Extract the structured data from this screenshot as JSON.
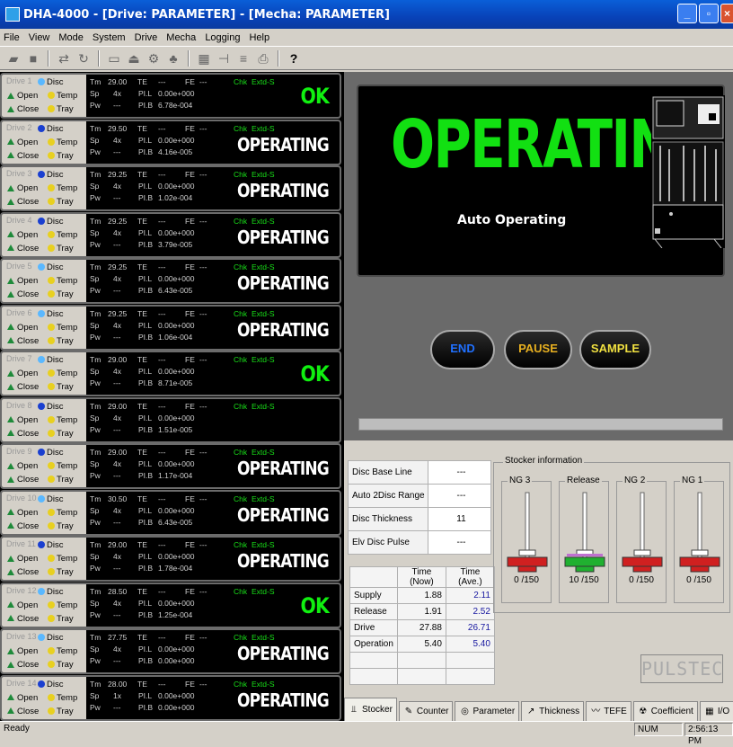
{
  "window": {
    "title": "DHA-4000 - [Drive: PARAMETER] - [Mecha: PARAMETER]"
  },
  "menu": [
    "File",
    "View",
    "Mode",
    "System",
    "Drive",
    "Mecha",
    "Logging",
    "Help"
  ],
  "drive_labels": {
    "disc": "Disc",
    "open": "Open",
    "temp": "Temp",
    "close": "Close",
    "tray": "Tray",
    "tm": "Tm",
    "sp": "Sp",
    "pw": "Pw",
    "te": "TE",
    "fe": "FE",
    "pil": "PI.L",
    "pib": "PI.B",
    "chk": "Chk",
    "extd": "Extd-S",
    "dash": "---"
  },
  "drives": [
    {
      "name": "Drive 1",
      "tm": "29.00",
      "sp": "4x",
      "pil": "0.00e+000",
      "pib": "6.78e-004",
      "status": "OK",
      "chk": "Chk",
      "disc_color": "#5ab8ff"
    },
    {
      "name": "Drive 2",
      "tm": "29.50",
      "sp": "4x",
      "pil": "0.00e+000",
      "pib": "4.16e-005",
      "status": "OPERATING",
      "chk": "",
      "disc_color": "#1a3fd0"
    },
    {
      "name": "Drive 3",
      "tm": "29.25",
      "sp": "4x",
      "pil": "0.00e+000",
      "pib": "1.02e-004",
      "status": "OPERATING",
      "chk": "",
      "disc_color": "#1a3fd0"
    },
    {
      "name": "Drive 4",
      "tm": "29.25",
      "sp": "4x",
      "pil": "0.00e+000",
      "pib": "3.79e-005",
      "status": "OPERATING",
      "chk": "",
      "disc_color": "#1a3fd0"
    },
    {
      "name": "Drive 5",
      "tm": "29.25",
      "sp": "4x",
      "pil": "0.00e+000",
      "pib": "6.43e-005",
      "status": "OPERATING",
      "chk": "",
      "disc_color": "#5ab8ff"
    },
    {
      "name": "Drive 6",
      "tm": "29.25",
      "sp": "4x",
      "pil": "0.00e+000",
      "pib": "1.06e-004",
      "status": "OPERATING",
      "chk": "",
      "disc_color": "#5ab8ff"
    },
    {
      "name": "Drive 7",
      "tm": "29.00",
      "sp": "4x",
      "pil": "0.00e+000",
      "pib": "8.71e-005",
      "status": "OK",
      "chk": "",
      "disc_color": "#5ab8ff"
    },
    {
      "name": "Drive 8",
      "tm": "29.00",
      "sp": "4x",
      "pil": "0.00e+000",
      "pib": "1.51e-005",
      "status": "",
      "chk": "Chk",
      "disc_color": "#1a3fd0"
    },
    {
      "name": "Drive 9",
      "tm": "29.00",
      "sp": "4x",
      "pil": "0.00e+000",
      "pib": "1.17e-004",
      "status": "OPERATING",
      "chk": "",
      "disc_color": "#1a3fd0"
    },
    {
      "name": "Drive 10",
      "tm": "30.50",
      "sp": "4x",
      "pil": "0.00e+000",
      "pib": "6.43e-005",
      "status": "OPERATING",
      "chk": "",
      "disc_color": "#5ab8ff"
    },
    {
      "name": "Drive 11",
      "tm": "29.00",
      "sp": "4x",
      "pil": "0.00e+000",
      "pib": "1.78e-004",
      "status": "OPERATING",
      "chk": "",
      "disc_color": "#1a3fd0"
    },
    {
      "name": "Drive 12",
      "tm": "28.50",
      "sp": "4x",
      "pil": "0.00e+000",
      "pib": "1.25e-004",
      "status": "OK",
      "chk": "",
      "disc_color": "#5ab8ff"
    },
    {
      "name": "Drive 13",
      "tm": "27.75",
      "sp": "4x",
      "pil": "0.00e+000",
      "pib": "0.00e+000",
      "status": "OPERATING",
      "chk": "",
      "disc_color": "#5ab8ff"
    },
    {
      "name": "Drive 14",
      "tm": "28.00",
      "sp": "1x",
      "pil": "0.00e+000",
      "pib": "0.00e+000",
      "status": "OPERATING",
      "chk": "",
      "disc_color": "#1a3fd0"
    }
  ],
  "main": {
    "status": "OPERATING",
    "mode": "Auto Operating",
    "end": "END",
    "pause": "PAUSE",
    "sample": "SAMPLE"
  },
  "info": [
    {
      "label": "Disc Base Line",
      "value": "---"
    },
    {
      "label": "Auto 2Disc Range",
      "value": "---"
    },
    {
      "label": "Disc Thickness",
      "value": "11"
    },
    {
      "label": "Elv Disc Pulse",
      "value": "---"
    }
  ],
  "times": {
    "header_now": "Time (Now)",
    "header_ave": "Time (Ave.)",
    "rows": [
      {
        "label": "Supply",
        "now": "1.88",
        "ave": "2.11"
      },
      {
        "label": "Release",
        "now": "1.91",
        "ave": "2.52"
      },
      {
        "label": "Drive",
        "now": "27.88",
        "ave": "26.71"
      },
      {
        "label": "Operation",
        "now": "5.40",
        "ave": "5.40"
      }
    ]
  },
  "stocker": {
    "title": "Stocker information",
    "groups": [
      {
        "label": "NG 3",
        "count": "0",
        "max": "/150",
        "color": "#d02020"
      },
      {
        "label": "Release",
        "count": "10",
        "max": "/150",
        "color": "#20b030"
      },
      {
        "label": "NG 2",
        "count": "0",
        "max": "/150",
        "color": "#d02020"
      },
      {
        "label": "NG 1",
        "count": "0",
        "max": "/150",
        "color": "#d02020"
      }
    ]
  },
  "logo": "PULSTEC",
  "tabs": [
    {
      "label": "Stocker",
      "icon": "stocker-icon"
    },
    {
      "label": "Counter",
      "icon": "counter-icon"
    },
    {
      "label": "Parameter",
      "icon": "parameter-icon"
    },
    {
      "label": "Thickness",
      "icon": "thickness-icon"
    },
    {
      "label": "TEFE",
      "icon": "tefe-icon"
    },
    {
      "label": "Coefficient",
      "icon": "coefficient-icon"
    },
    {
      "label": "I/O",
      "icon": "io-icon"
    }
  ],
  "status": {
    "text": "Ready",
    "num": "NUM",
    "clock": "2:56:13 PM"
  }
}
